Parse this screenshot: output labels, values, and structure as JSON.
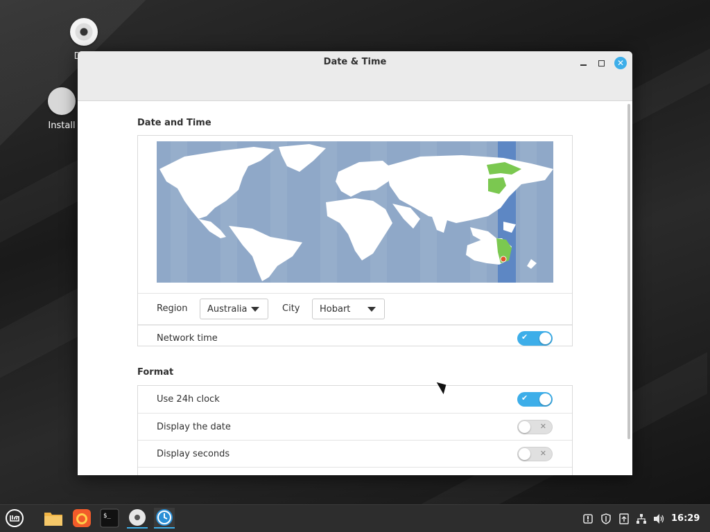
{
  "desktop": {
    "icons": [
      {
        "label": "DVD",
        "icon": "dvd-disc-icon"
      },
      {
        "label": "Install",
        "icon": "install-disc-icon"
      }
    ]
  },
  "window": {
    "title": "Date & Time",
    "sections": {
      "date_time": {
        "title": "Date and Time",
        "region_label": "Region",
        "region_value": "Australia",
        "city_label": "City",
        "city_value": "Hobart",
        "network_time_label": "Network time",
        "network_time_enabled": true
      },
      "format": {
        "title": "Format",
        "rows": [
          {
            "label": "Use 24h clock",
            "enabled": true
          },
          {
            "label": "Display the date",
            "enabled": false
          },
          {
            "label": "Display seconds",
            "enabled": false
          }
        ]
      }
    }
  },
  "taskbar": {
    "apps": [
      "menu-icon",
      "files-icon",
      "firefox-icon",
      "terminal-icon",
      "disc-icon",
      "datetime-icon"
    ],
    "tray": [
      "notification-icon",
      "shield-icon",
      "update-icon",
      "network-icon",
      "volume-icon"
    ],
    "clock": "16:29"
  },
  "colors": {
    "accent": "#3daee9",
    "map_ocean": "#8fa8c8",
    "map_land": "#ffffff",
    "timezone_highlight": "#7bc850"
  }
}
